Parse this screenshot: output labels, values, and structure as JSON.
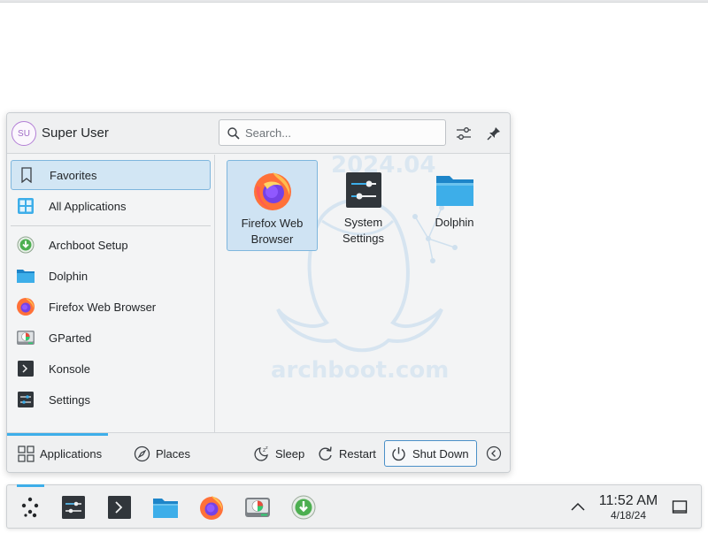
{
  "header": {
    "avatar_initials": "SU",
    "user_name": "Super User",
    "search_placeholder": "Search..."
  },
  "sidebar": {
    "items": [
      {
        "label": "Favorites",
        "icon": "bookmark-icon"
      },
      {
        "label": "All Applications",
        "icon": "grid-icon"
      },
      {
        "label": "Archboot Setup",
        "icon": "download-icon"
      },
      {
        "label": "Dolphin",
        "icon": "folder-icon"
      },
      {
        "label": "Firefox Web Browser",
        "icon": "firefox-icon"
      },
      {
        "label": "GParted",
        "icon": "disk-icon"
      },
      {
        "label": "Konsole",
        "icon": "terminal-icon"
      },
      {
        "label": "Settings",
        "icon": "settings-icon"
      }
    ]
  },
  "favorites": [
    {
      "line1": "Firefox Web",
      "line2": "Browser",
      "icon": "firefox-icon"
    },
    {
      "line1": "System",
      "line2": "Settings",
      "icon": "settings-icon"
    },
    {
      "line1": "Dolphin",
      "line2": "",
      "icon": "folder-icon"
    }
  ],
  "watermark": {
    "year": "2024.04",
    "site": "archboot.com"
  },
  "footer": {
    "applications": "Applications",
    "places": "Places",
    "sleep": "Sleep",
    "restart": "Restart",
    "shutdown": "Shut Down"
  },
  "panel": {
    "time": "11:52 AM",
    "date": "4/18/24"
  },
  "colors": {
    "accent": "#3daee9",
    "selection": "#d2e6f4"
  }
}
